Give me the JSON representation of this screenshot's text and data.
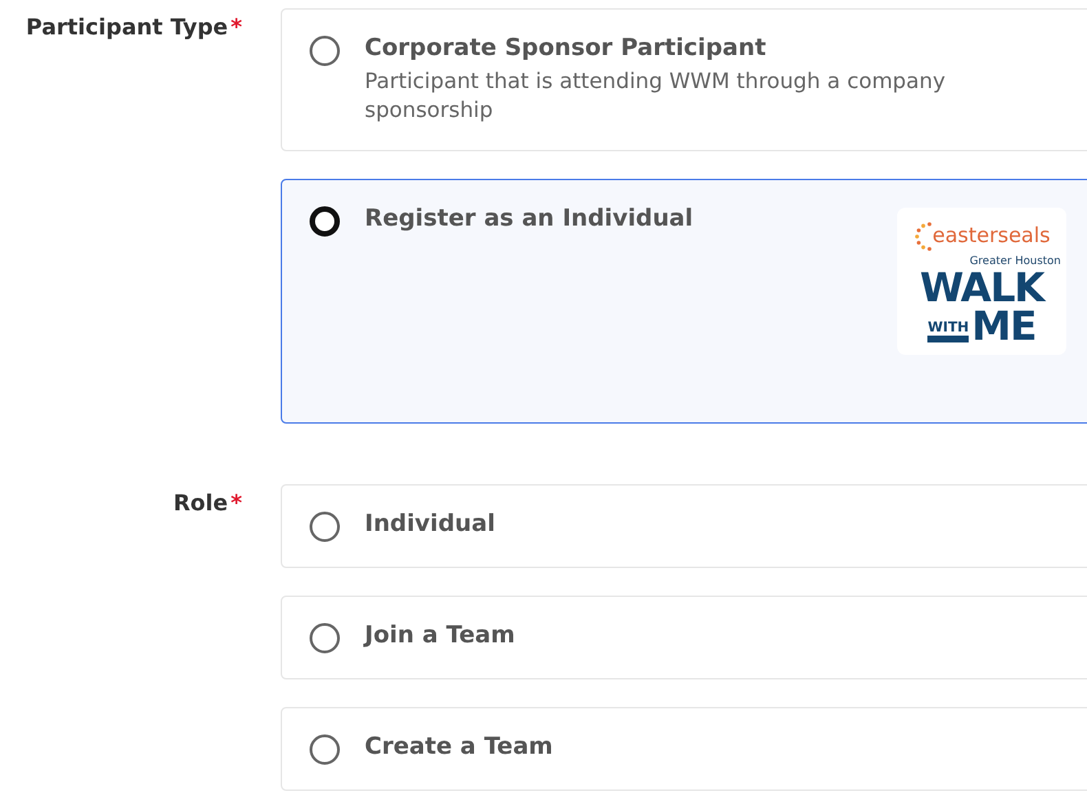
{
  "fields": [
    {
      "label": "Participant Type",
      "required_mark": "*",
      "options": [
        {
          "title": "Corporate Sponsor Participant",
          "description": "Participant that is attending WWM through a company sponsorship",
          "selected": false
        },
        {
          "title": "Register as an Individual",
          "selected": true,
          "logo": {
            "brand": "easterseals",
            "region": "Greater Houston",
            "line_1": "WALK",
            "line_2_small": "WITH",
            "line_2_big": "ME"
          }
        }
      ]
    },
    {
      "label": "Role",
      "required_mark": "*",
      "options": [
        {
          "title": "Individual",
          "selected": false
        },
        {
          "title": "Join a Team",
          "selected": false
        },
        {
          "title": "Create a Team",
          "selected": false
        }
      ]
    }
  ]
}
